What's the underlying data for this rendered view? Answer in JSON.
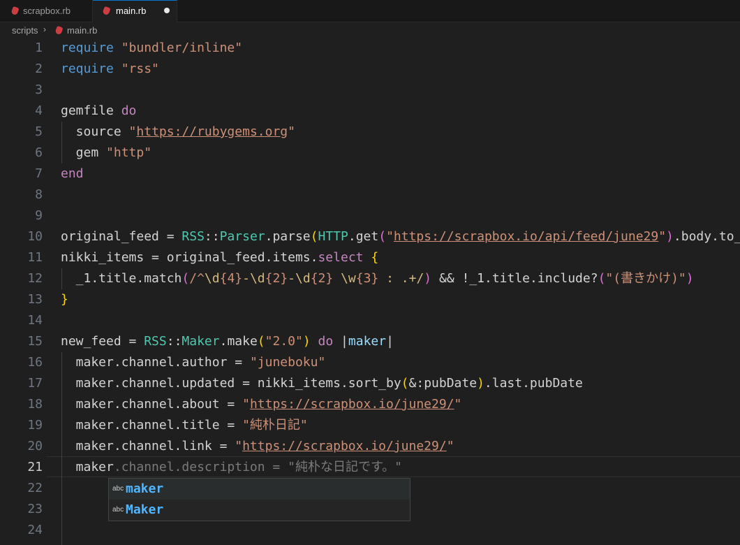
{
  "tabs": [
    {
      "label": "scrapbox.rb",
      "icon": "ruby-file-icon",
      "active": false
    },
    {
      "label": "main.rb",
      "icon": "ruby-file-icon",
      "active": true,
      "dirty": true
    }
  ],
  "breadcrumb": {
    "folder": "scripts",
    "file": "main.rb"
  },
  "editor": {
    "current_line": 21,
    "line_numbers": [
      "1",
      "2",
      "3",
      "4",
      "5",
      "6",
      "7",
      "8",
      "9",
      "10",
      "11",
      "12",
      "13",
      "14",
      "15",
      "16",
      "17",
      "18",
      "19",
      "20",
      "21",
      "22",
      "23",
      "24"
    ]
  },
  "code": {
    "l1": {
      "kw": "require",
      "str": "\"bundler/inline\""
    },
    "l2": {
      "kw": "require",
      "str": "\"rss\""
    },
    "l4": {
      "a": "gemfile ",
      "kw": "do"
    },
    "l5": {
      "a": "  source ",
      "q1": "\"",
      "url": "https://rubygems.org",
      "q2": "\""
    },
    "l6": {
      "a": "  gem ",
      "str": "\"http\""
    },
    "l7": {
      "kw": "end"
    },
    "l10": {
      "a": "original_feed = ",
      "c1": "RSS",
      "b": "::",
      "c2": "Parser",
      "c": ".parse",
      "p1": "(",
      "c3": "HTTP",
      "d": ".get",
      "p2": "(",
      "q1": "\"",
      "url": "https://scrapbox.io/api/feed/june29",
      "q2": "\"",
      "p3": ")",
      "e": ".body.to_s",
      "p4": ")"
    },
    "l11": {
      "a": "nikki_items = original_feed.items.",
      "fn": "select",
      "sp": " ",
      "br": "{"
    },
    "l12": {
      "a": "  _1.title.match",
      "p1": "(",
      "r1": "/^",
      "r2": "\\d",
      "r3": "{4}",
      "r4": "-",
      "r5": "\\d",
      "r6": "{2}",
      "r7": "-",
      "r8": "\\d",
      "r9": "{2}",
      "r10": " ",
      "r11": "\\w",
      "r12": "{3}",
      "r13": " : .+/",
      "p2": ")",
      "b": " && !_1.title.include?",
      "p3": "(",
      "str": "\"(書きかけ)\"",
      "p4": ")"
    },
    "l13": {
      "br": "}"
    },
    "l15": {
      "a": "new_feed = ",
      "c1": "RSS",
      "b": "::",
      "c2": "Maker",
      "c": ".make",
      "p1": "(",
      "str": "\"2.0\"",
      "p2": ")",
      "sp": " ",
      "kw": "do",
      "sp2": " ",
      "pipe1": "|",
      "var": "maker",
      "pipe2": "|"
    },
    "l16": {
      "a": "  maker.channel.author = ",
      "str": "\"juneboku\""
    },
    "l17": {
      "a": "  maker.channel.updated = nikki_items.sort_by",
      "p1": "(",
      "b": "&:pubDate",
      "p2": ")",
      "c": ".last.pubDate"
    },
    "l18": {
      "a": "  maker.channel.about = ",
      "q1": "\"",
      "url": "https://scrapbox.io/june29/",
      "q2": "\""
    },
    "l19": {
      "a": "  maker.channel.title = ",
      "str": "\"純朴日記\""
    },
    "l20": {
      "a": "  maker.channel.link = ",
      "q1": "\"",
      "url": "https://scrapbox.io/june29/",
      "q2": "\""
    },
    "l21": {
      "a": "  maker",
      "ghost": ".channel.description = \"純朴な日記です。\""
    }
  },
  "suggestions": [
    {
      "kind": "abc",
      "label": "maker"
    },
    {
      "kind": "abc",
      "label": "Maker"
    }
  ],
  "colors": {
    "accent": "#0078d4",
    "keyword": "#569cd6",
    "string": "#ce9178",
    "class": "#4ec9b0"
  }
}
